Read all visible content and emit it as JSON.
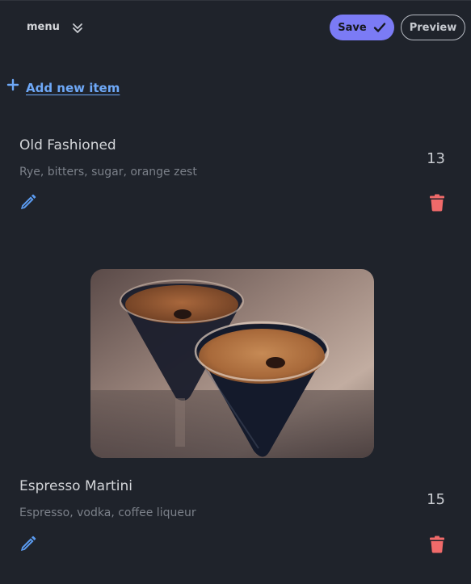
{
  "header": {
    "menu_label": "menu",
    "menu_icon": "double-chevron-down-icon",
    "save_label": "Save",
    "save_icon": "check-icon",
    "preview_label": "Preview"
  },
  "add_item": {
    "label": "Add new item",
    "icon": "plus-icon"
  },
  "items": [
    {
      "name": "Old Fashioned",
      "description": "Rye, bitters, sugar, orange zest",
      "price": "13",
      "edit_icon": "pencil-icon",
      "delete_icon": "trash-icon",
      "has_photo": false
    },
    {
      "name": "Espresso Martini",
      "description": "Espresso, vodka, coffee liqueur",
      "price": "15",
      "edit_icon": "pencil-icon",
      "delete_icon": "trash-icon",
      "has_photo": true
    }
  ],
  "colors": {
    "background": "#1f232b",
    "accent": "#7b7bf5",
    "link": "#6ea8f7",
    "edit": "#5b9bf0",
    "delete": "#f06a6a"
  }
}
